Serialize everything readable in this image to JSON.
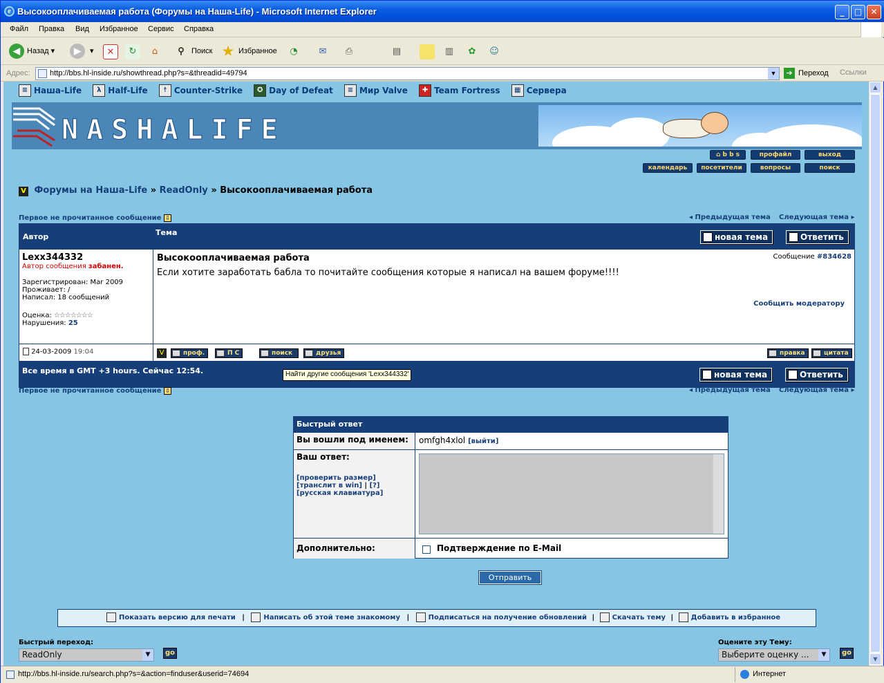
{
  "window": {
    "title": "Высокооплачиваемая работа (Форумы на Наша-Life) - Microsoft Internet Explorer",
    "min": "_",
    "max": "□",
    "close": "✕"
  },
  "menu": [
    "Файл",
    "Правка",
    "Вид",
    "Избранное",
    "Сервис",
    "Справка"
  ],
  "toolbar": {
    "back": "Назад",
    "search": "Поиск",
    "favorites": "Избранное"
  },
  "address": {
    "label": "Адрес:",
    "url": "http://bbs.hl-inside.ru/showthread.php?s=&threadid=49794",
    "go": "Переход",
    "links": "Ссылки"
  },
  "sitenav": [
    "Наша-Life",
    "Half-Life",
    "Counter-Strike",
    "Day of Defeat",
    "Мир Valve",
    "Team Fortress",
    "Сервера"
  ],
  "logo": "NASHALIFE",
  "topbuttons": {
    "bbs": "b b s",
    "profile": "профайл",
    "logout": "выход",
    "calendar": "календарь",
    "visitors": "посетители",
    "faq": "вопросы",
    "search": "поиск"
  },
  "breadcrumb": {
    "forums": "Форумы на Наша-Life",
    "sep": "»",
    "readonly": "ReadOnly",
    "current": "Высокооплачиваемая работа"
  },
  "thread": {
    "first_unread": "Первое не прочитанное сообщение",
    "prev": "Предыдущая тема",
    "next": "Следующая тема",
    "col_author": "Автор",
    "col_topic": "Тема",
    "new_topic": "новая тема",
    "reply": "Ответить",
    "author": "Lexx344332",
    "author_status_prefix": "Автор сообщения ",
    "author_status": "забанен.",
    "registered": "Зарегистрирован: Mar 2009",
    "location": "Проживает: /",
    "posts": "Написал: 18 сообщений",
    "rating_label": "Оценка:",
    "rating_stars": "☆☆☆☆☆☆☆",
    "violations_label": "Нарушения:",
    "violations": "25",
    "post_title": "Высокооплачиваемая работа",
    "post_body": "Если хотите заработать бабла то почитайте сообщения которые я написал на вашем форуме!!!!",
    "msg_label": "Сообщение",
    "msg_num": "#834628",
    "report": "Сообщить модератору",
    "date": "24-03-2009",
    "time": "19:04",
    "btn_prof": "проф.",
    "btn_pm": "П С",
    "btn_search": "поиск",
    "btn_friends": "друзья",
    "btn_edit": "правка",
    "btn_quote": "цитата",
    "timezone": "Все время в GMT +3 hours. Сейчас 12:54.",
    "tooltip": "Найти другие сообщения 'Lexx344332'"
  },
  "quickreply": {
    "title": "Быстрый ответ",
    "logged_label": "Вы вошли под именем:",
    "username": "omfgh4xlol",
    "logout": "[выйти]",
    "your_reply": "Ваш ответ:",
    "check_size": "[проверить размер]",
    "translit": "[транслит в win]",
    "pipe": "|",
    "help": "[?]",
    "rus_kbd": "[русская клавиатура]",
    "extra": "Дополнительно:",
    "email_confirm": "Подтверждение по E-Mail",
    "submit": "Отправить"
  },
  "footer": {
    "print": "Показать версию для печати",
    "email": "Написать об этой теме знакомому",
    "subscribe": "Подписаться на получение обновлений",
    "download": "Скачать тему",
    "fav": "Добавить в избранное",
    "sep": "|"
  },
  "jump": {
    "label": "Быстрый переход:",
    "value": "ReadOnly",
    "go": "go"
  },
  "rate": {
    "label": "Оцените эту Тему:",
    "value": "Выберите оценку ...",
    "go": "go"
  },
  "status": {
    "url": "http://bbs.hl-inside.ru/search.php?s=&action=finduser&userid=74694",
    "zone": "Интернет"
  }
}
